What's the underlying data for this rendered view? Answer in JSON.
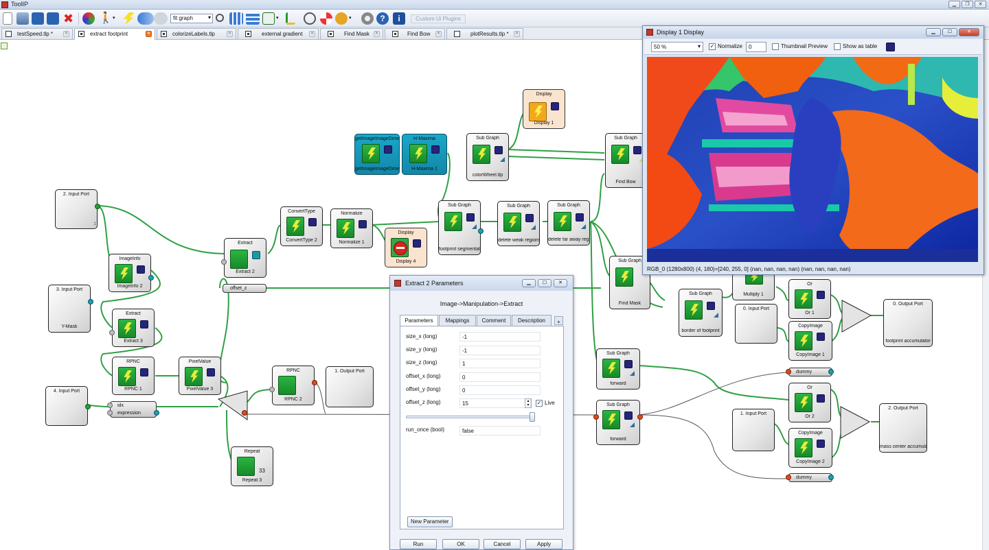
{
  "app": {
    "title": "ToolIP"
  },
  "toolbar": {
    "zoom_mode": "fit graph",
    "custom_plugins": "Custom Ui Plugins"
  },
  "tabs": [
    {
      "label": "testSpeed.tlp *"
    },
    {
      "label": "extract footprint"
    },
    {
      "label": "colorizeLabels.tlp"
    },
    {
      "label": "external gradient"
    },
    {
      "label": "Find Mask"
    },
    {
      "label": "Find Bow"
    },
    {
      "label": "plotResults.tlp *"
    }
  ],
  "nodes": {
    "input2": {
      "title": "2. Input Port"
    },
    "input3": {
      "title": "3. Input Port",
      "name": "Y-Mask"
    },
    "input4": {
      "title": "4. Input Port"
    },
    "imageinfo": {
      "title": "ImageInfo",
      "name": "ImageInfo 2"
    },
    "extract3": {
      "title": "Extract",
      "name": "Extract 3"
    },
    "rpnc1": {
      "title": "RPNC",
      "name": "RPNC 1"
    },
    "pixelvalue": {
      "title": "PixelValue",
      "name": "PixelValue 3"
    },
    "rpnc2": {
      "title": "RPNC",
      "name": "RPNC 2"
    },
    "output1": {
      "title": "1. Output Port"
    },
    "repeat": {
      "title": "Repeat",
      "name": "Repeat 3",
      "count": "33"
    },
    "extract2": {
      "title": "Extract",
      "name": "Extract 2"
    },
    "offsetz": {
      "label": "offset_z"
    },
    "expression": {
      "label1": "idx",
      "label2": "expression"
    },
    "converttype": {
      "title": "ConvertType",
      "name": "ConvertType 2"
    },
    "normalize": {
      "title": "Normalize",
      "name": "Normalize 1"
    },
    "display4": {
      "title": "Display",
      "name": "Display 4"
    },
    "getimagedim": {
      "title": "getImageImageDimensions",
      "name": "getImageImageDimensions"
    },
    "hmaxima": {
      "title": "H-Maxima",
      "name": "H-Maxima 1"
    },
    "colorwheel": {
      "title": "Sub Graph",
      "name": "colorWheel.tlp"
    },
    "display1": {
      "title": "Display",
      "name": "Display 1"
    },
    "findbow": {
      "title": "Sub Graph",
      "name": "Find Bow"
    },
    "footprintseg": {
      "title": "Sub Graph",
      "name": "footprint segmentation"
    },
    "deleteweak": {
      "title": "Sub Graph",
      "name": "delete weak regions"
    },
    "deletefar": {
      "title": "Sub Graph",
      "name": "delete far away regions"
    },
    "findmask": {
      "title": "Sub Graph",
      "name": "Find Mask"
    },
    "borderfootprint": {
      "title": "Sub Graph",
      "name": "border of footprint"
    },
    "multiply": {
      "name": "Multiply 1"
    },
    "input0": {
      "title": "0. Input Port"
    },
    "or1": {
      "title": "Or",
      "name": "Or 1"
    },
    "copyimage1": {
      "title": "CopyImage",
      "name": "CopyImage 1"
    },
    "output0": {
      "title": "0. Output Port",
      "name": "footprint accumulator"
    },
    "forward1": {
      "title": "Sub Graph",
      "name": "forward"
    },
    "forward2": {
      "title": "Sub Graph",
      "name": "forward"
    },
    "dummy1": {
      "label": "dummy"
    },
    "dummy2": {
      "label": "dummy"
    },
    "input1b": {
      "title": "1. Input Port"
    },
    "or2": {
      "title": "Or",
      "name": "Or 2"
    },
    "copyimage2": {
      "title": "CopyImage",
      "name": "CopyImage 2"
    },
    "output2": {
      "title": "2. Output Port",
      "name": "mass center accumulator"
    }
  },
  "display_window": {
    "title": "Display 1 Display",
    "zoom": "50 %",
    "normalize_label": "Normalize",
    "normalize_checked": true,
    "spin_value": "0",
    "thumbnail_label": "Thumbnail Preview",
    "table_label": "Show as table",
    "status": "RGB_0  (1280x800)  (4, 180)=[240, 255, 0]  (nan, nan, nan, nan)  (nan, nan, nan, nan)",
    "swatch_color": "#25267a"
  },
  "params_dialog": {
    "title": "Extract 2 Parameters",
    "path": "Image->Manipulation->Extract",
    "tabs": [
      "Parameters",
      "Mappings",
      "Comment",
      "Description",
      "+"
    ],
    "rows": [
      {
        "label": "size_x (long)",
        "value": "-1"
      },
      {
        "label": "size_y (long)",
        "value": "-1"
      },
      {
        "label": "size_z (long)",
        "value": "1"
      },
      {
        "label": "offset_x (long)",
        "value": "0"
      },
      {
        "label": "offset_y (long)",
        "value": "0"
      },
      {
        "label": "offset_z (long)",
        "value": "15"
      },
      {
        "label": "run_once (bool)",
        "value": "false"
      }
    ],
    "live_label": "Live",
    "new_param": "New Parameter",
    "buttons": {
      "run": "Run",
      "ok": "OK",
      "cancel": "Cancel",
      "apply": "Apply"
    }
  },
  "colors": {
    "wire": "#2ea043",
    "node_green": "#22a03a",
    "node_blue": "#1aa7c9",
    "accent_orange": "#f07c22"
  }
}
